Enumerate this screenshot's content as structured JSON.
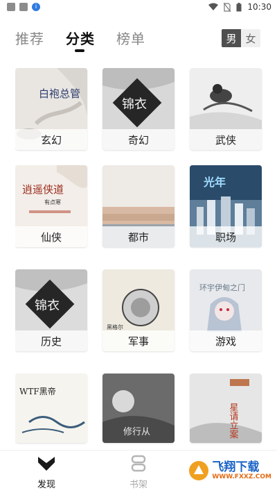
{
  "status_bar": {
    "time": "10:30"
  },
  "top_tabs": [
    {
      "label": "推荐",
      "active": false
    },
    {
      "label": "分类",
      "active": true
    },
    {
      "label": "榜单",
      "active": false
    }
  ],
  "gender_toggle": {
    "male": "男",
    "female": "女",
    "selected": "男"
  },
  "categories": [
    {
      "label": "玄幻",
      "cover_title": "白袍总管"
    },
    {
      "label": "奇幻",
      "cover_title": "锦衣"
    },
    {
      "label": "武侠"
    },
    {
      "label": "仙侠",
      "cover_title": "逍遥侠道",
      "cover_sub": "有点寒"
    },
    {
      "label": "都市"
    },
    {
      "label": "职场",
      "cover_title": "光年"
    },
    {
      "label": "历史",
      "cover_title": "锦衣"
    },
    {
      "label": "军事",
      "cover_title": "黑格尔"
    },
    {
      "label": "游戏",
      "cover_title": "环宇伊甸之门"
    },
    {
      "label": "",
      "cover_title": "WTF黑帝"
    },
    {
      "label": "",
      "cover_title": "修行从"
    },
    {
      "label": "",
      "cover_title": "星请立案"
    }
  ],
  "bottom_nav": [
    {
      "label": "发现",
      "icon": "discover-icon",
      "active": true
    },
    {
      "label": "书架",
      "icon": "bookshelf-icon",
      "active": false
    }
  ],
  "watermark": {
    "title": "飞翔下载",
    "url": "WWW.FXXZ.COM"
  },
  "colors": {
    "accent": "#111111",
    "toggle_on": "#4f4f4f",
    "watermark_blue": "#1b63c6"
  }
}
